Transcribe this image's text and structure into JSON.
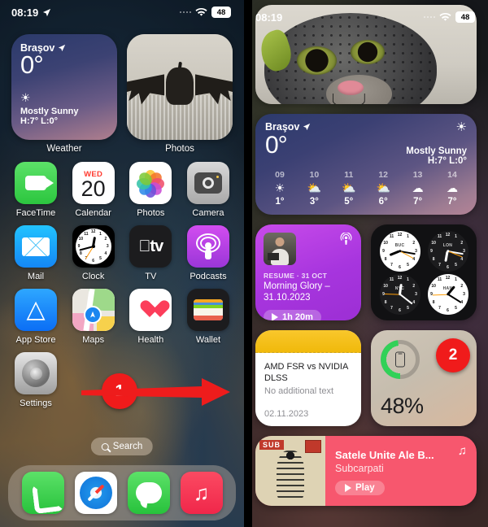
{
  "status_bar": {
    "time": "08:19",
    "location_icon": "location-arrow-icon",
    "wifi_icon": "wifi-icon",
    "battery_level": "48"
  },
  "left_screen": {
    "weather_widget": {
      "city": "Braşov",
      "location_icon": "location-arrow-icon",
      "temperature": "0°",
      "condition_icon": "☀",
      "condition": "Mostly Sunny",
      "high_low": "H:7° L:0°",
      "label": "Weather"
    },
    "photos_widget": {
      "label": "Photos",
      "image_description": "dragon-figure-photo"
    },
    "apps": [
      {
        "name": "FaceTime",
        "icon": "facetime-icon"
      },
      {
        "name": "Calendar",
        "icon": "calendar-icon",
        "weekday": "WED",
        "day": "20"
      },
      {
        "name": "Photos",
        "icon": "photos-icon"
      },
      {
        "name": "Camera",
        "icon": "camera-icon"
      },
      {
        "name": "Mail",
        "icon": "mail-icon"
      },
      {
        "name": "Clock",
        "icon": "clock-icon"
      },
      {
        "name": "TV",
        "icon": "tv-icon",
        "glyph": "TV"
      },
      {
        "name": "Podcasts",
        "icon": "podcasts-icon"
      },
      {
        "name": "App Store",
        "icon": "app-store-icon"
      },
      {
        "name": "Maps",
        "icon": "maps-icon"
      },
      {
        "name": "Health",
        "icon": "health-icon"
      },
      {
        "name": "Wallet",
        "icon": "wallet-icon"
      },
      {
        "name": "Settings",
        "icon": "settings-icon"
      }
    ],
    "clock_numerals": [
      "12",
      "1",
      "2",
      "3",
      "4",
      "5",
      "6",
      "7",
      "8",
      "9",
      "10",
      "11"
    ],
    "annotation": {
      "number": "1",
      "shape": "red-right-arrow",
      "color": "#f01b1b"
    },
    "search_pill": {
      "label": "Search",
      "icon": "search-icon"
    },
    "dock": [
      {
        "name": "Phone",
        "icon": "phone-icon"
      },
      {
        "name": "Safari",
        "icon": "safari-icon"
      },
      {
        "name": "Messages",
        "icon": "messages-icon"
      },
      {
        "name": "Music",
        "icon": "music-icon"
      }
    ]
  },
  "right_screen": {
    "photo_widget": {
      "image_description": "plush-cat-toy-photo"
    },
    "weather_widget": {
      "city": "Braşov",
      "location_icon": "location-arrow-icon",
      "temperature": "0°",
      "condition": "Mostly Sunny",
      "high_low": "H:7° L:0°",
      "condition_icon": "☀",
      "forecast": [
        {
          "hour": "09",
          "icon": "☀",
          "temp": "1°"
        },
        {
          "hour": "10",
          "icon": "⛅",
          "temp": "3°"
        },
        {
          "hour": "11",
          "icon": "⛅",
          "temp": "5°"
        },
        {
          "hour": "12",
          "icon": "⛅",
          "temp": "6°"
        },
        {
          "hour": "13",
          "icon": "☁",
          "temp": "7°"
        },
        {
          "hour": "14",
          "icon": "☁",
          "temp": "7°"
        }
      ]
    },
    "podcast_widget": {
      "meta": "RESUME · 31 OCT",
      "title": "Morning Glory – 31.10.2023",
      "play_label": "1h 20m",
      "badge_icon": "podcasts-icon"
    },
    "clocks_widget": [
      {
        "label": "BUC",
        "theme": "light",
        "hour_deg": 248,
        "minute_deg": 100,
        "second_deg": 118
      },
      {
        "label": "LON",
        "theme": "dark",
        "hour_deg": 190,
        "minute_deg": 100,
        "second_deg": 112
      },
      {
        "label": "NYC",
        "theme": "dark",
        "hour_deg": 8,
        "minute_deg": 128,
        "second_deg": 272
      },
      {
        "label": "HAN",
        "theme": "light",
        "hour_deg": 40,
        "minute_deg": 122,
        "second_deg": 268
      }
    ],
    "clock_numerals": [
      "12",
      "1",
      "2",
      "3",
      "4",
      "5",
      "6",
      "7",
      "8",
      "9",
      "10",
      "11"
    ],
    "notes_widget": {
      "title": "AMD FSR vs NVIDIA DLSS",
      "subtitle": "No additional text",
      "date": "02.11.2023"
    },
    "battery_widget": {
      "percent": "48%",
      "device_icon": "iphone-icon",
      "ring_color": "#31d158",
      "annotation": {
        "number": "2",
        "color": "#f01b1b"
      }
    },
    "music_widget": {
      "title": "Satele Unite Ale B...",
      "artist": "Subcarpati",
      "play_label": "Play",
      "note_icon": "music-note-icon",
      "art_description": "subcarpati-album-art"
    }
  }
}
